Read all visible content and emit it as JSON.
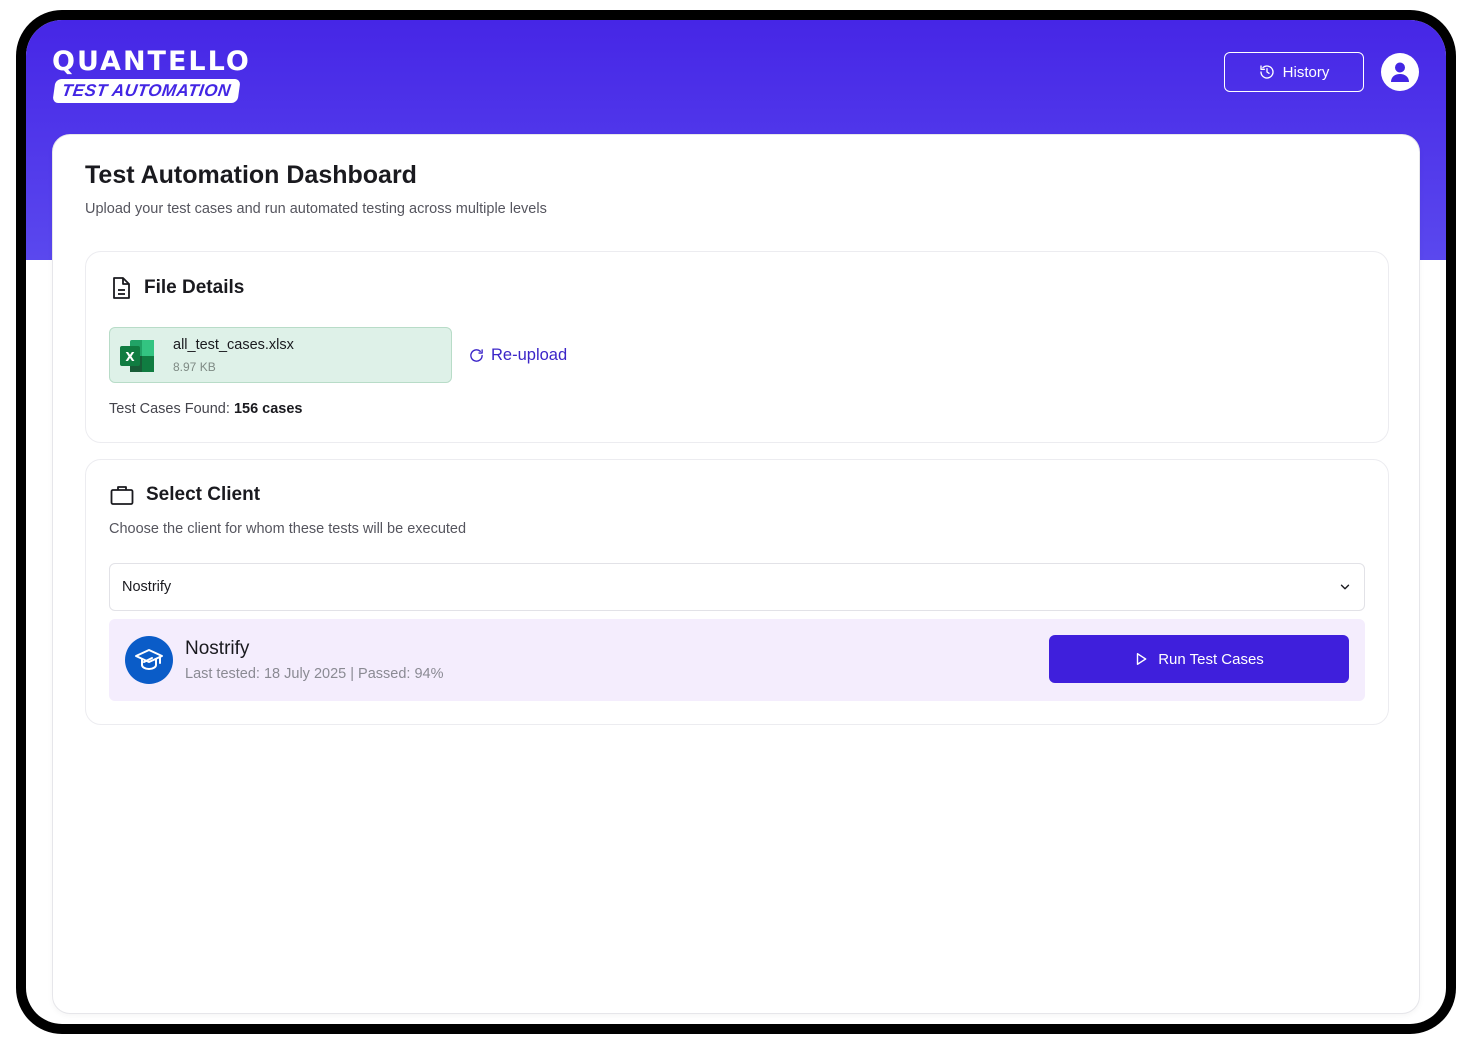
{
  "brand": {
    "name": "QUANTELLO",
    "tagline": "TEST AUTOMATION"
  },
  "header": {
    "history_label": "History",
    "history_icon": "history-icon",
    "avatar_icon": "user-icon"
  },
  "page": {
    "title": "Test Automation Dashboard",
    "subtitle": "Upload your test cases and run automated testing across multiple levels"
  },
  "file_details": {
    "title": "File Details",
    "icon": "document-icon",
    "file": {
      "name": "all_test_cases.xlsx",
      "size": "8.97 KB",
      "icon": "excel-icon"
    },
    "reupload_label": "Re-upload",
    "found_label": "Test Cases Found:",
    "found_value": "156 cases"
  },
  "select_client": {
    "title": "Select Client",
    "icon": "briefcase-icon",
    "description": "Choose the client for whom these tests will be executed",
    "selected": "Nostrify",
    "client": {
      "name": "Nostrify",
      "meta": "Last tested: 18 July 2025 | Passed: 94%",
      "icon": "graduation-cap-icon"
    },
    "run_label": "Run Test Cases"
  },
  "colors": {
    "brand": "#4626e6",
    "accent": "#3f1fdc",
    "file_bg": "#def1e8",
    "client_bg": "#f4edfd",
    "client_logo": "#0a5cc8"
  }
}
